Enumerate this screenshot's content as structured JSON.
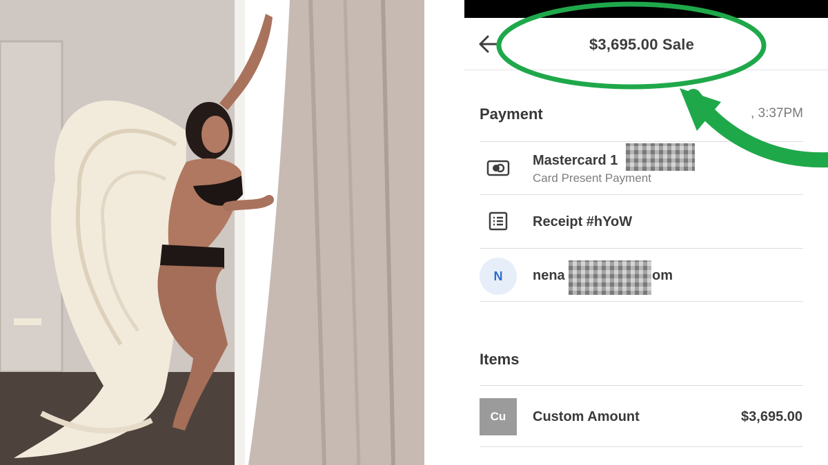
{
  "header": {
    "title": "$3,695.00 Sale",
    "back_icon": "arrow-left-icon"
  },
  "payment": {
    "section_title": "Payment",
    "time": ", 3:37PM",
    "card": {
      "label": "Mastercard 1",
      "sub": "Card Present Payment",
      "icon": "credit-card-icon"
    },
    "receipt": {
      "label": "Receipt #hYoW",
      "icon": "receipt-icon"
    },
    "customer": {
      "initial": "N",
      "email_prefix": "nena",
      "email_suffix": "om"
    }
  },
  "items": {
    "section_title": "Items",
    "list": [
      {
        "thumb": "Cu",
        "name": "Custom Amount",
        "price": "$3,695.00"
      }
    ]
  },
  "annotation": {
    "color": "#1fa84a",
    "shapes": [
      "ellipse-highlight",
      "curved-arrow"
    ]
  },
  "colors": {
    "avatar_bg": "#e6eef9",
    "avatar_text": "#2d6ccf",
    "thumb_bg": "#9b9b9b"
  }
}
